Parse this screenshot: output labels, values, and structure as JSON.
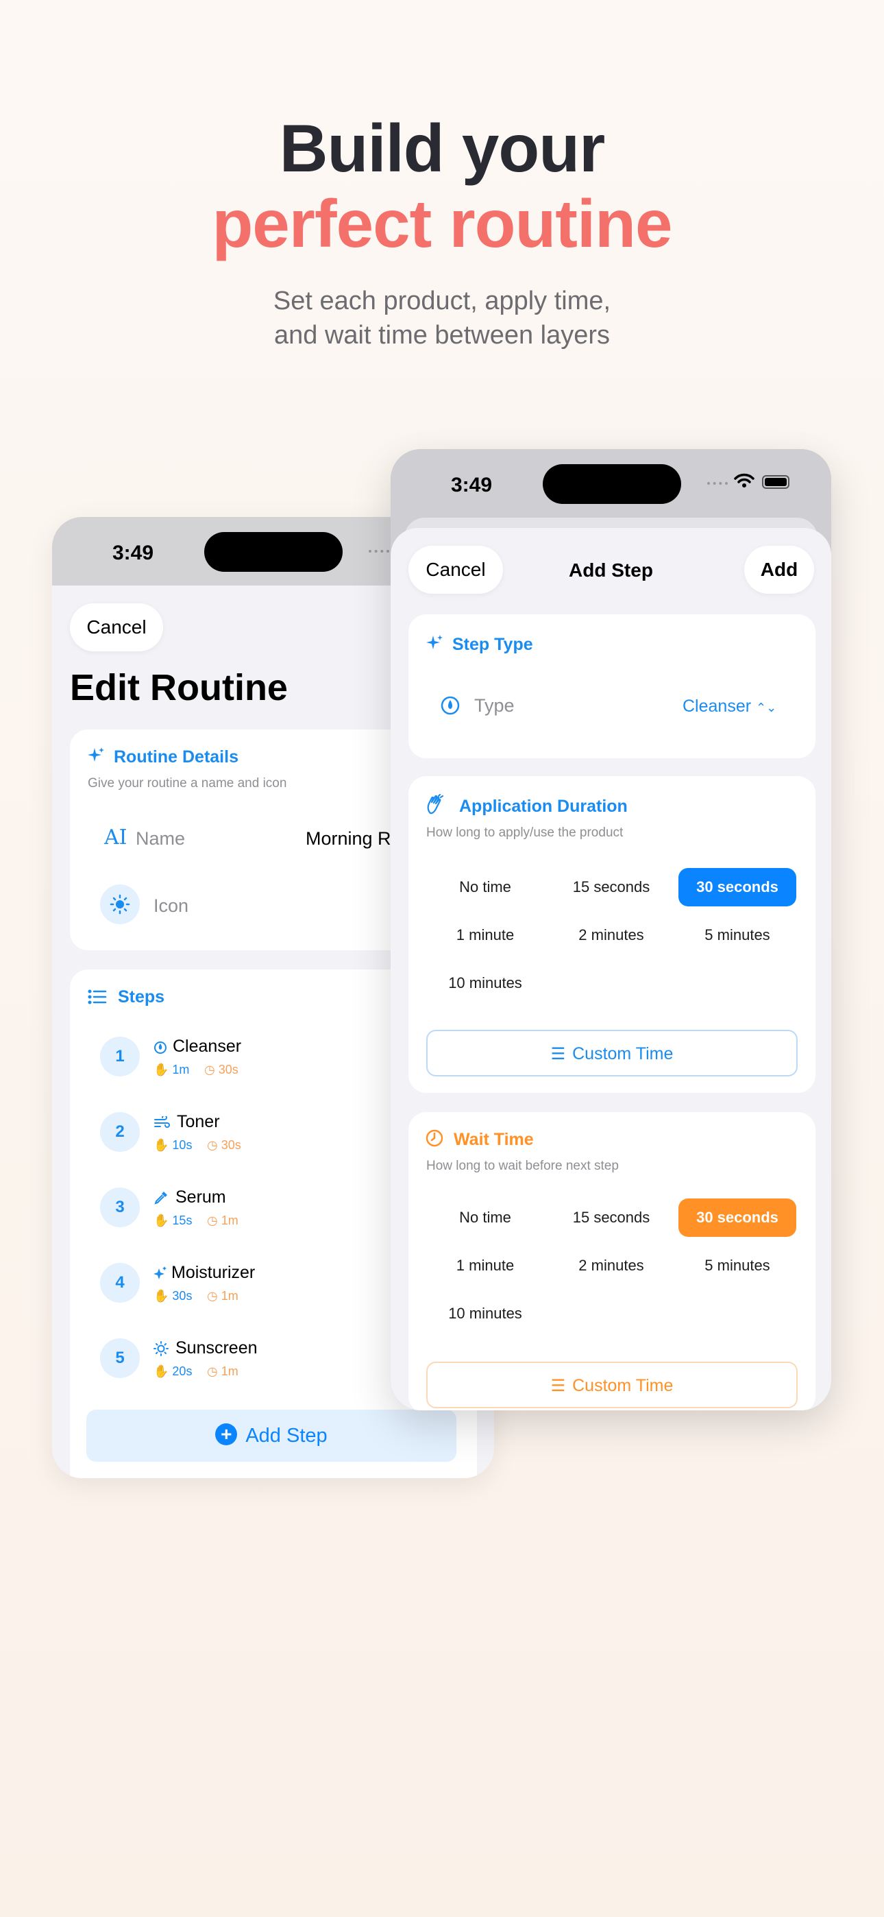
{
  "hero": {
    "line1": "Build your",
    "line2": "perfect routine",
    "subtitle_line1": "Set each product, apply time,",
    "subtitle_line2": "and wait time between layers"
  },
  "left_phone": {
    "time": "3:49",
    "cancel_label": "Cancel",
    "title": "Edit Routine",
    "details": {
      "title": "Routine Details",
      "subtitle": "Give your routine a name and icon",
      "name_label": "Name",
      "name_value": "Morning R",
      "icon_label": "Icon"
    },
    "steps_title": "Steps",
    "steps": [
      {
        "num": "1",
        "name": "Cleanser",
        "apply": "1m",
        "wait": "30s"
      },
      {
        "num": "2",
        "name": "Toner",
        "apply": "10s",
        "wait": "30s"
      },
      {
        "num": "3",
        "name": "Serum",
        "apply": "15s",
        "wait": "1m"
      },
      {
        "num": "4",
        "name": "Moisturizer",
        "apply": "30s",
        "wait": "1m"
      },
      {
        "num": "5",
        "name": "Sunscreen",
        "apply": "20s",
        "wait": "1m"
      }
    ],
    "add_step_label": "Add Step"
  },
  "right_phone": {
    "time": "3:49",
    "cancel_label": "Cancel",
    "title": "Add Step",
    "add_label": "Add",
    "step_type": {
      "title": "Step Type",
      "type_label": "Type",
      "type_value": "Cleanser"
    },
    "application": {
      "title": "Application Duration",
      "subtitle": "How long to apply/use the product",
      "options": [
        "No time",
        "15 seconds",
        "30 seconds",
        "1 minute",
        "2 minutes",
        "5 minutes",
        "10 minutes"
      ],
      "selected": "30 seconds",
      "custom_label": "Custom Time"
    },
    "wait": {
      "title": "Wait Time",
      "subtitle": "How long to wait before next step",
      "options": [
        "No time",
        "15 seconds",
        "30 seconds",
        "1 minute",
        "2 minutes",
        "5 minutes",
        "10 minutes"
      ],
      "selected": "30 seconds",
      "custom_label": "Custom Time"
    }
  },
  "colors": {
    "accent_blue": "#0a84ff",
    "accent_orange": "#ff9127",
    "headline_coral": "#f4706a"
  }
}
